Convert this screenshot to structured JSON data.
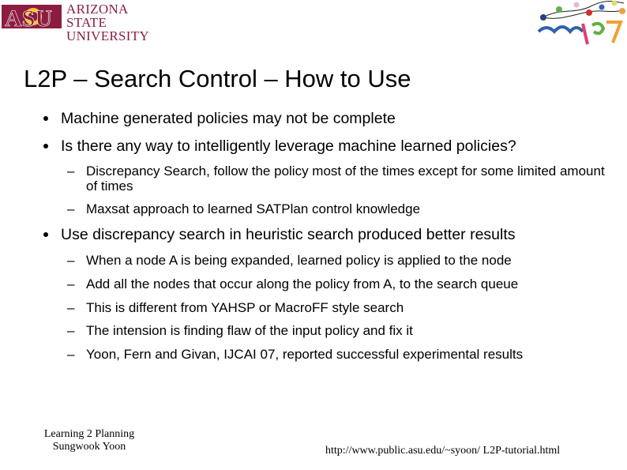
{
  "header": {
    "asu_logo": {
      "line1": "ARIZONA STATE",
      "line2": "UNIVERSITY",
      "mark": "ASU",
      "color": "#8c1d40",
      "sun_color": "#ffc627"
    },
    "icaps_logo": {
      "text": "icaps07"
    }
  },
  "slide": {
    "title": "L2P – Search Control – How to Use",
    "bullets": [
      {
        "text": "Machine generated policies may not be complete",
        "sub": []
      },
      {
        "text": "Is there any way to intelligently leverage machine learned policies?",
        "sub": [
          "Discrepancy Search, follow the policy most of the times except for some limited amount of times",
          "Maxsat approach to learned SATPlan control knowledge"
        ]
      },
      {
        "text": "Use discrepancy search in heuristic search produced better results",
        "sub": [
          "When a node A is being expanded, learned policy is applied to the node",
          "Add all the nodes that occur along the policy from A, to the search queue",
          "This is different from YAHSP or MacroFF style search",
          "The intension is finding flaw of the input policy and fix it",
          "Yoon, Fern and Givan, IJCAI 07, reported successful experimental results"
        ]
      }
    ],
    "dash": "–"
  },
  "footer": {
    "left_line1": "Learning 2 Planning",
    "left_line2": "Sungwook Yoon",
    "url": "http://www.public.asu.edu/~syoon/ L2P-tutorial.html"
  }
}
